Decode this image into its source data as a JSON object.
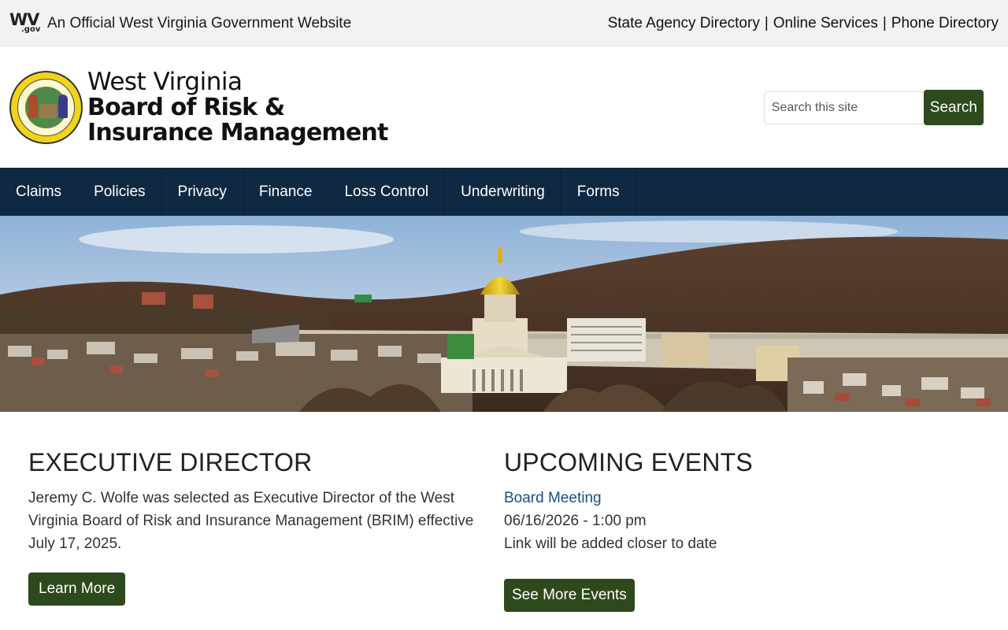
{
  "topbar": {
    "logo_text": "WV",
    "logo_sub": ".gov",
    "official_text": "An Official West Virginia Government Website",
    "links": [
      "State Agency Directory",
      "Online Services",
      "Phone Directory"
    ],
    "separator": "|"
  },
  "header": {
    "line1": "West Virginia",
    "line2": "Board of Risk &",
    "line3": "Insurance Management",
    "search_placeholder": "Search this site",
    "search_button": "Search"
  },
  "nav": {
    "items": [
      "Claims",
      "Policies",
      "Privacy",
      "Finance",
      "Loss Control",
      "Underwriting",
      "Forms"
    ]
  },
  "executive": {
    "heading": "EXECUTIVE DIRECTOR",
    "body": "Jeremy C. Wolfe was selected as Executive Director of the West Virginia Board of Risk and Insurance Management (BRIM) effective July 17, 2025.",
    "button": "Learn More"
  },
  "events": {
    "heading": "UPCOMING EVENTS",
    "event_title": "Board Meeting",
    "event_datetime": "06/16/2026 - 1:00 pm",
    "event_note": "Link will be added closer to date",
    "button": "See More Events"
  },
  "colors": {
    "nav_bg": "#0f2942",
    "button_bg": "#2e4a1c",
    "link": "#1a4e8a",
    "topbar_bg": "#f2f2f2"
  }
}
